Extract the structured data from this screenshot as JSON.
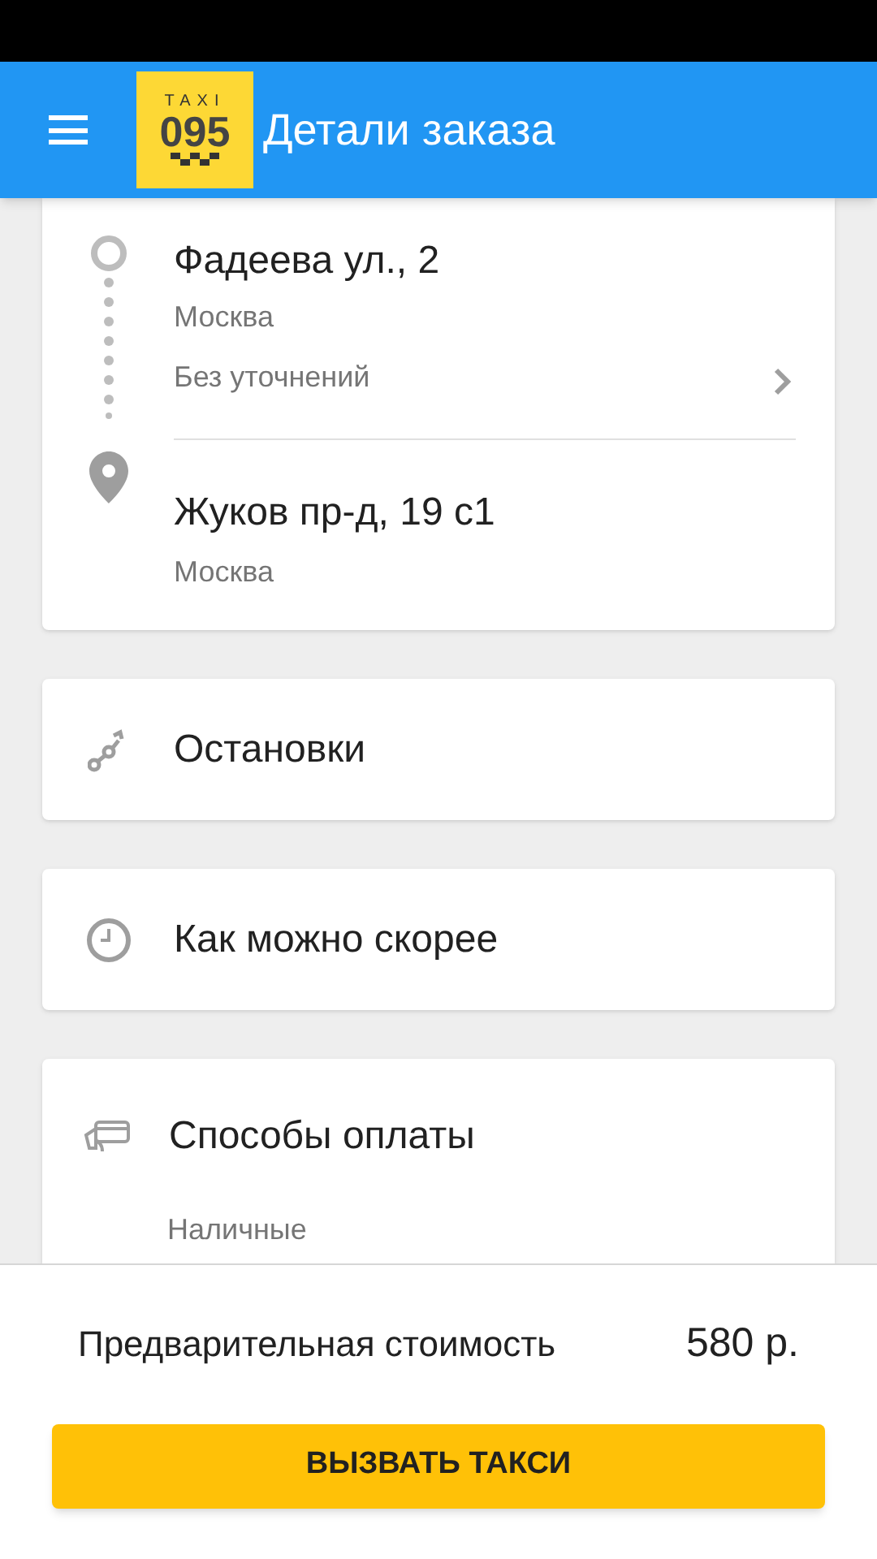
{
  "app_bar": {
    "logo_top": "TAXI",
    "logo_main": "095",
    "title": "Детали заказа"
  },
  "route": {
    "from": {
      "address": "Фадеева ул., 2",
      "city": "Москва",
      "note": "Без уточнений"
    },
    "to": {
      "address": "Жуков пр-д, 19 с1",
      "city": "Москва"
    }
  },
  "stops": {
    "label": "Остановки"
  },
  "time": {
    "label": "Как можно скорее"
  },
  "payment": {
    "label": "Способы оплаты",
    "value": "Наличные"
  },
  "price": {
    "label": "Предварительная стоимость",
    "value": "580 р."
  },
  "call_button": "ВЫЗВАТЬ ТАКСИ"
}
